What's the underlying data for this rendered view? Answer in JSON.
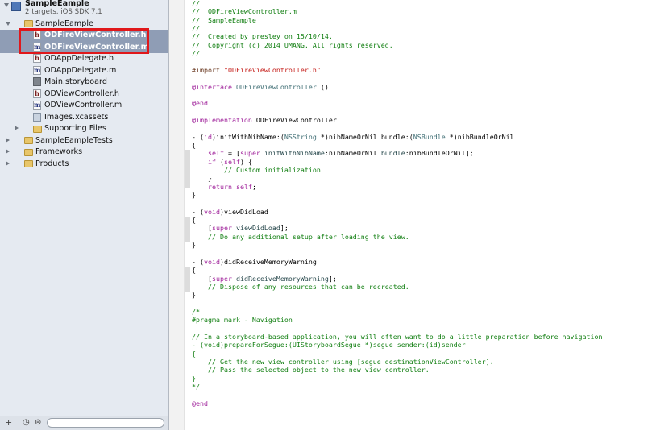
{
  "navigator": {
    "project_name": "SampleEample",
    "project_subtitle": "2 targets, iOS SDK 7.1",
    "items": [
      {
        "label": "SampleEample",
        "kind": "folder",
        "indent": 1,
        "disclosure": "open"
      },
      {
        "label": "ODFireViewController.h",
        "kind": "h",
        "indent": 2,
        "selected": true
      },
      {
        "label": "ODFireViewController.m",
        "kind": "m",
        "indent": 2,
        "selected": true
      },
      {
        "label": "ODAppDelegate.h",
        "kind": "h",
        "indent": 2
      },
      {
        "label": "ODAppDelegate.m",
        "kind": "m",
        "indent": 2
      },
      {
        "label": "Main.storyboard",
        "kind": "storyboard",
        "indent": 2
      },
      {
        "label": "ODViewController.h",
        "kind": "h",
        "indent": 2
      },
      {
        "label": "ODViewController.m",
        "kind": "m",
        "indent": 2
      },
      {
        "label": "Images.xcassets",
        "kind": "assets",
        "indent": 2
      },
      {
        "label": "Supporting Files",
        "kind": "folder",
        "indent": 2,
        "disclosure": "closed"
      },
      {
        "label": "SampleEampleTests",
        "kind": "folder",
        "indent": 1,
        "disclosure": "closed"
      },
      {
        "label": "Frameworks",
        "kind": "folder",
        "indent": 1,
        "disclosure": "closed"
      },
      {
        "label": "Products",
        "kind": "folder",
        "indent": 1,
        "disclosure": "closed"
      }
    ],
    "footer": {
      "add": "+",
      "recent": "◷",
      "filter_icon": "⊜"
    }
  },
  "editor": {
    "lines": [
      [
        [
          "comment",
          "//"
        ]
      ],
      [
        [
          "comment",
          "//  ODFireViewController.m"
        ]
      ],
      [
        [
          "comment",
          "//  SampleEample"
        ]
      ],
      [
        [
          "comment",
          "//"
        ]
      ],
      [
        [
          "comment",
          "//  Created by presley on 15/10/14."
        ]
      ],
      [
        [
          "comment",
          "//  Copyright (c) 2014 UMANG. All rights reserved."
        ]
      ],
      [
        [
          "comment",
          "//"
        ]
      ],
      [],
      [
        [
          "pre",
          "#import "
        ],
        [
          "str",
          "\"ODFireViewController.h\""
        ]
      ],
      [],
      [
        [
          "kw",
          "@interface"
        ],
        [
          "plain",
          " "
        ],
        [
          "class",
          "ODFireViewController"
        ],
        [
          "plain",
          " ()"
        ]
      ],
      [],
      [
        [
          "kw",
          "@end"
        ]
      ],
      [],
      [
        [
          "kw",
          "@implementation"
        ],
        [
          "plain",
          " ODFireViewController"
        ]
      ],
      [],
      [
        [
          "plain",
          "- ("
        ],
        [
          "kw",
          "id"
        ],
        [
          "plain",
          ")initWithNibName:("
        ],
        [
          "class",
          "NSString"
        ],
        [
          "plain",
          " *)nibNameOrNil bundle:("
        ],
        [
          "class",
          "NSBundle"
        ],
        [
          "plain",
          " *)nibBundleOrNil"
        ]
      ],
      [
        [
          "plain",
          "{"
        ]
      ],
      [
        [
          "plain",
          "    "
        ],
        [
          "kw",
          "self"
        ],
        [
          "plain",
          " = ["
        ],
        [
          "kw",
          "super"
        ],
        [
          "plain",
          " "
        ],
        [
          "meth",
          "initWithNibName"
        ],
        [
          "plain",
          ":nibNameOrNil "
        ],
        [
          "meth",
          "bundle"
        ],
        [
          "plain",
          ":nibBundleOrNil];"
        ]
      ],
      [
        [
          "plain",
          "    "
        ],
        [
          "kw",
          "if"
        ],
        [
          "plain",
          " ("
        ],
        [
          "kw",
          "self"
        ],
        [
          "plain",
          ") {"
        ]
      ],
      [
        [
          "plain",
          "        "
        ],
        [
          "comment",
          "// Custom initialization"
        ]
      ],
      [
        [
          "plain",
          "    }"
        ]
      ],
      [
        [
          "plain",
          "    "
        ],
        [
          "kw",
          "return"
        ],
        [
          "plain",
          " "
        ],
        [
          "kw",
          "self"
        ],
        [
          "plain",
          ";"
        ]
      ],
      [
        [
          "plain",
          "}"
        ]
      ],
      [],
      [
        [
          "plain",
          "- ("
        ],
        [
          "kw",
          "void"
        ],
        [
          "plain",
          ")viewDidLoad"
        ]
      ],
      [
        [
          "plain",
          "{"
        ]
      ],
      [
        [
          "plain",
          "    ["
        ],
        [
          "kw",
          "super"
        ],
        [
          "plain",
          " "
        ],
        [
          "meth",
          "viewDidLoad"
        ],
        [
          "plain",
          "];"
        ]
      ],
      [
        [
          "plain",
          "    "
        ],
        [
          "comment",
          "// Do any additional setup after loading the view."
        ]
      ],
      [
        [
          "plain",
          "}"
        ]
      ],
      [],
      [
        [
          "plain",
          "- ("
        ],
        [
          "kw",
          "void"
        ],
        [
          "plain",
          ")didReceiveMemoryWarning"
        ]
      ],
      [
        [
          "plain",
          "{"
        ]
      ],
      [
        [
          "plain",
          "    ["
        ],
        [
          "kw",
          "super"
        ],
        [
          "plain",
          " "
        ],
        [
          "meth",
          "didReceiveMemoryWarning"
        ],
        [
          "plain",
          "];"
        ]
      ],
      [
        [
          "plain",
          "    "
        ],
        [
          "comment",
          "// Dispose of any resources that can be recreated."
        ]
      ],
      [
        [
          "plain",
          "}"
        ]
      ],
      [],
      [
        [
          "comment",
          "/*"
        ]
      ],
      [
        [
          "comment",
          "#pragma mark - Navigation"
        ]
      ],
      [],
      [
        [
          "comment",
          "// In a storyboard-based application, you will often want to do a little preparation before navigation"
        ]
      ],
      [
        [
          "comment",
          "- (void)prepareForSegue:(UIStoryboardSegue *)segue sender:(id)sender"
        ]
      ],
      [
        [
          "comment",
          "{"
        ]
      ],
      [
        [
          "comment",
          "    // Get the new view controller using [segue destinationViewController]."
        ]
      ],
      [
        [
          "comment",
          "    // Pass the selected object to the new view controller."
        ]
      ],
      [
        [
          "comment",
          "}"
        ]
      ],
      [
        [
          "comment",
          "*/"
        ]
      ],
      [],
      [
        [
          "kw",
          "@end"
        ]
      ]
    ]
  }
}
